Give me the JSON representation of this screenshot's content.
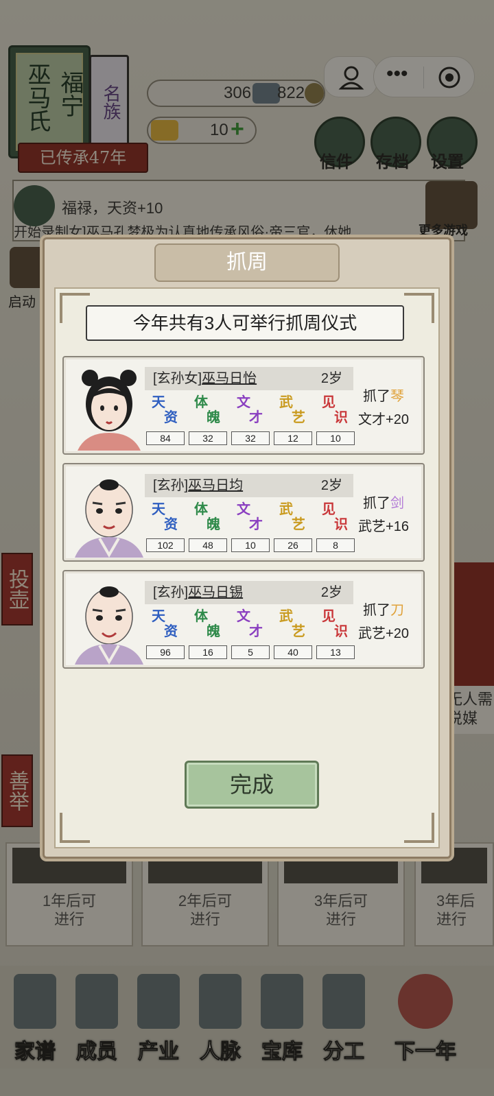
{
  "header": {
    "family_name_a": "福宁",
    "family_name_b": "巫马氏",
    "family_rank": "名族",
    "heritage": "已传承47年",
    "coins": "306",
    "copper": "822",
    "gold_ingots": "10",
    "letters_label": "信件",
    "save_label": "存档",
    "settings_label": "设置",
    "more_games_label": "更多游戏",
    "record_label": "开始录制",
    "start_label": "启动"
  },
  "scroll": {
    "line1": "福禄，天资+10",
    "line2": "开始录制女]巫马孔梦极为认真地传承风俗·帝三官，休她"
  },
  "side": {
    "left_top": "投壶",
    "left_bottom": "善举",
    "right_card_line1": "无人需",
    "right_card_line2": "说媒"
  },
  "bottom_cards": [
    {
      "line1": "1年后可",
      "line2": "进行"
    },
    {
      "line1": "2年后可",
      "line2": "进行"
    },
    {
      "line1": "3年后可",
      "line2": "进行"
    },
    {
      "line1": "3年后",
      "line2": "进行"
    }
  ],
  "nav": [
    "家谱",
    "成员",
    "产业",
    "人脉",
    "宝库",
    "分工",
    "下一年"
  ],
  "modal": {
    "title": "抓周",
    "subtitle": "今年共有3人可举行抓周仪式",
    "stat_labels": [
      {
        "a": "天",
        "b": "资",
        "color": "#2f5fc0"
      },
      {
        "a": "体",
        "b": "魄",
        "color": "#2f8a4a"
      },
      {
        "a": "文",
        "b": "才",
        "color": "#8a3fc0"
      },
      {
        "a": "武",
        "b": "艺",
        "color": "#c99a1e"
      },
      {
        "a": "见",
        "b": "识",
        "color": "#c9383a"
      }
    ],
    "children": [
      {
        "title": "[玄孙女]",
        "name": "巫马日怡",
        "age": "2岁",
        "stats": [
          "84",
          "32",
          "32",
          "12",
          "10"
        ],
        "grab_prefix": "抓了",
        "item": "琴",
        "item_color": "#e0a23a",
        "effect": "文才+20"
      },
      {
        "title": "[玄孙]",
        "name": "巫马日均",
        "age": "2岁",
        "stats": [
          "102",
          "48",
          "10",
          "26",
          "8"
        ],
        "grab_prefix": "抓了",
        "item": "剑",
        "item_color": "#b27ad6",
        "effect": "武艺+16"
      },
      {
        "title": "[玄孙]",
        "name": "巫马日锡",
        "age": "2岁",
        "stats": [
          "96",
          "16",
          "5",
          "40",
          "13"
        ],
        "grab_prefix": "抓了",
        "item": "刀",
        "item_color": "#e0a23a",
        "effect": "武艺+20"
      }
    ],
    "done_label": "完成"
  }
}
